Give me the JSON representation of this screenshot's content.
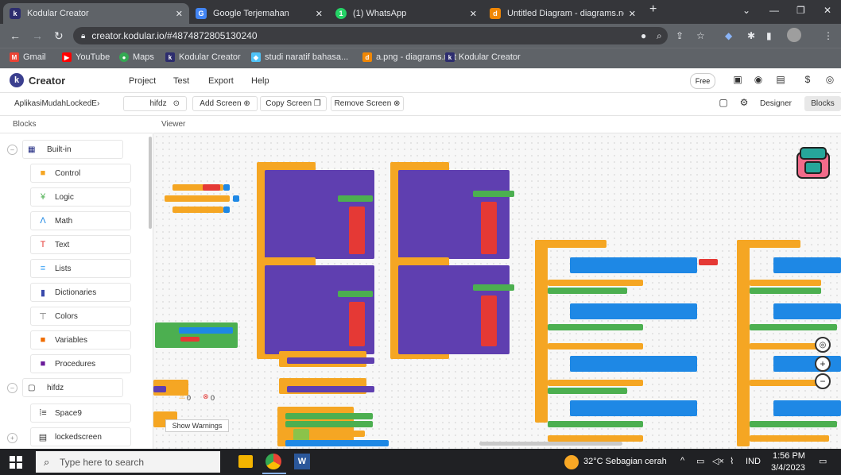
{
  "browser": {
    "tabs": [
      {
        "title": "Kodular Creator",
        "color": "#2d2d6e",
        "glyph": "k"
      },
      {
        "title": "Google Terjemahan",
        "color": "#4285f4",
        "glyph": "G"
      },
      {
        "title": "(1) WhatsApp",
        "color": "#25d366",
        "glyph": "1"
      },
      {
        "title": "Untitled Diagram - diagrams.net",
        "color": "#f08705",
        "glyph": "d"
      }
    ],
    "url": "creator.kodular.io/#4874872805130240",
    "bookmarks": [
      "Gmail",
      "YouTube",
      "Maps",
      "Kodular Creator",
      "studi naratif bahasa...",
      "a.png - diagrams.net",
      "Kodular Creator"
    ]
  },
  "app": {
    "name": "Creator",
    "menu": [
      "Project",
      "Test",
      "Export",
      "Help"
    ],
    "plan": "Free",
    "project_name": "AplikasiMudahLockedE›",
    "screen_name": "hifdz",
    "buttons": {
      "add_screen": "Add Screen ⊕",
      "copy_screen": "Copy Screen ❐",
      "remove_screen": "Remove Screen ⊗"
    },
    "designer": "Designer",
    "blocks": "Blocks"
  },
  "panel": {
    "blocks_title": "Blocks",
    "viewer_title": "Viewer",
    "builtin": "Built-in",
    "categories": [
      {
        "label": "Control",
        "icon": "control-icon",
        "color": "#f5a623"
      },
      {
        "label": "Logic",
        "icon": "logic-icon",
        "color": "#4caf50"
      },
      {
        "label": "Math",
        "icon": "math-icon",
        "color": "#1e88e5"
      },
      {
        "label": "Text",
        "icon": "text-icon",
        "color": "#e53935"
      },
      {
        "label": "Lists",
        "icon": "lists-icon",
        "color": "#42a5f5"
      },
      {
        "label": "Dictionaries",
        "icon": "dictionaries-icon",
        "color": "#3949ab"
      },
      {
        "label": "Colors",
        "icon": "colors-icon",
        "color": "#757575"
      },
      {
        "label": "Variables",
        "icon": "variables-icon",
        "color": "#ef6c00"
      },
      {
        "label": "Procedures",
        "icon": "procedures-icon",
        "color": "#6a1b9a"
      }
    ],
    "screen_group": "hifdz",
    "screen_children": [
      "Space9"
    ],
    "locked_group": "lockedscreen"
  },
  "workspace": {
    "warnings_label": "Show Warnings",
    "warnings_count": "0",
    "errors_count": "0"
  },
  "taskbar": {
    "search_placeholder": "Type here to search",
    "weather": "32°C  Sebagian cerah",
    "language": "IND",
    "time": "1:56 PM",
    "date": "3/4/2023"
  }
}
